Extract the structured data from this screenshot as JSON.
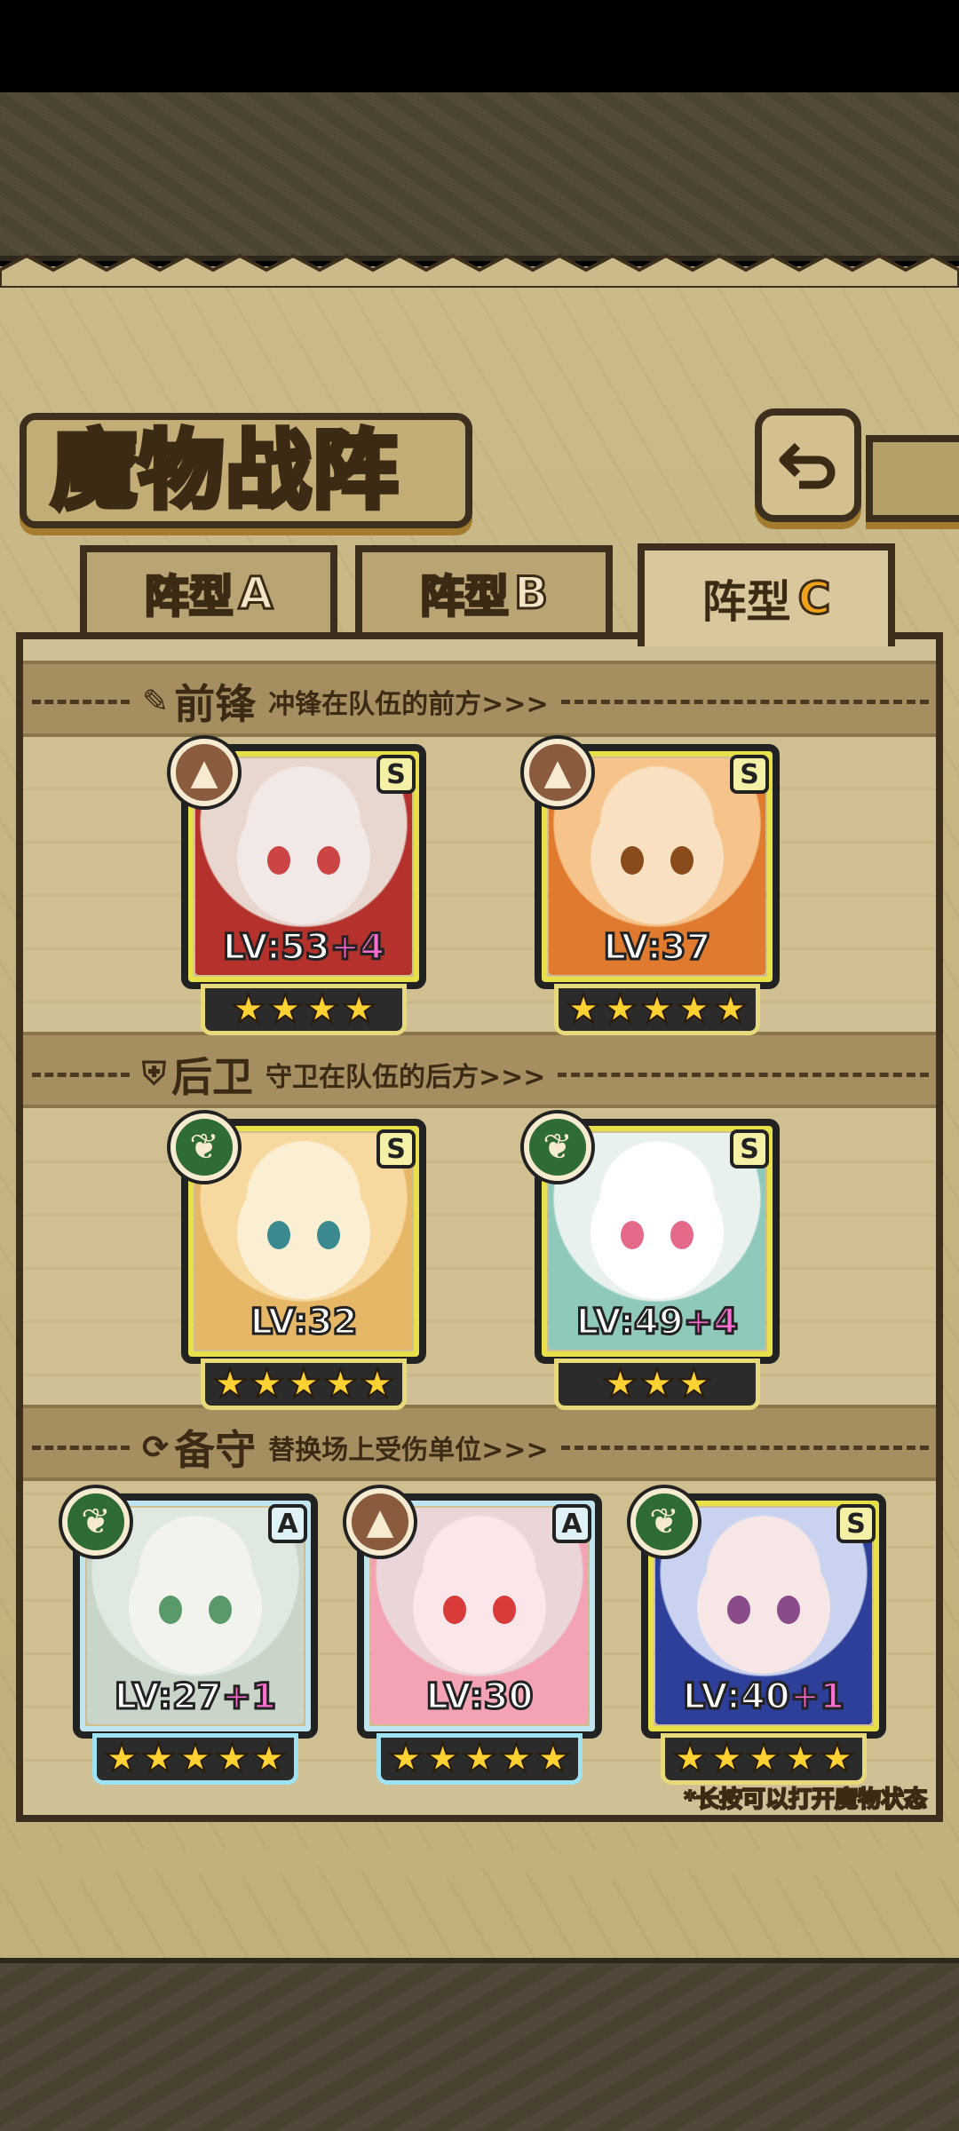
{
  "header": {
    "title": "魔物战阵"
  },
  "tabs": [
    {
      "label_main": "阵型",
      "label_suffix": "A",
      "active": false
    },
    {
      "label_main": "阵型",
      "label_suffix": "B",
      "active": false
    },
    {
      "label_main": "阵型",
      "label_suffix": "C",
      "active": true
    }
  ],
  "sections": [
    {
      "icon": "sword-icon",
      "glyph": "✎",
      "name": "前锋",
      "desc": "冲锋在队伍的前方>>>",
      "units": [
        {
          "rank": "S",
          "element": "mountain",
          "level_label": "LV:",
          "level": "53",
          "bonus": "+4",
          "stars": 4
        },
        {
          "rank": "S",
          "element": "mountain",
          "level_label": "LV:",
          "level": "37",
          "bonus": "",
          "stars": 5
        }
      ]
    },
    {
      "icon": "shield-icon",
      "glyph": "⛨",
      "name": "后卫",
      "desc": "守卫在队伍的后方>>>",
      "units": [
        {
          "rank": "S",
          "element": "leaf",
          "level_label": "LV:",
          "level": "32",
          "bonus": "",
          "stars": 5
        },
        {
          "rank": "S",
          "element": "leaf",
          "level_label": "LV:",
          "level": "49",
          "bonus": "+4",
          "stars": 3
        }
      ]
    },
    {
      "icon": "swap-icon",
      "glyph": "⟳",
      "name": "备守",
      "desc": "替换场上受伤单位>>>",
      "units": [
        {
          "rank": "A",
          "element": "leaf",
          "level_label": "LV:",
          "level": "27",
          "bonus": "+1",
          "stars": 5
        },
        {
          "rank": "A",
          "element": "mountain",
          "level_label": "LV:",
          "level": "30",
          "bonus": "",
          "stars": 5
        },
        {
          "rank": "S",
          "element": "leaf",
          "level_label": "LV:",
          "level": "40",
          "bonus": "+1",
          "stars": 5
        }
      ]
    }
  ],
  "hint": "*长按可以打开魔物状态",
  "colors": {
    "accent": "#f0a21a",
    "frame": "#3c2f1d",
    "panel": "#cbbb8a",
    "plus": "#ff6fd2"
  }
}
